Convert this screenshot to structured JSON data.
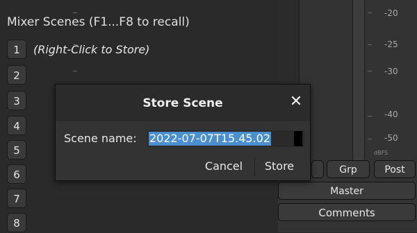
{
  "scenes": {
    "title": "Mixer Scenes (F1...F8 to recall)",
    "hint": "(Right-Click to Store)",
    "buttons": [
      "1",
      "2",
      "3",
      "4",
      "5",
      "6",
      "7",
      "8"
    ]
  },
  "meter": {
    "db_labels": [
      "-20",
      "-25",
      "-30",
      "-40",
      "-50"
    ],
    "unit": "dBFS"
  },
  "mixer_buttons": {
    "grp": "Grp",
    "post": "Post",
    "master": "Master",
    "comments": "Comments"
  },
  "dialog": {
    "title": "Store Scene",
    "close_glyph": "✕",
    "field_label": "Scene name:",
    "field_value": "2022-07-07T15.45.02",
    "cancel": "Cancel",
    "store": "Store"
  },
  "colors": {
    "selection": "#4a8fd0",
    "background": "#2a2a2a"
  }
}
